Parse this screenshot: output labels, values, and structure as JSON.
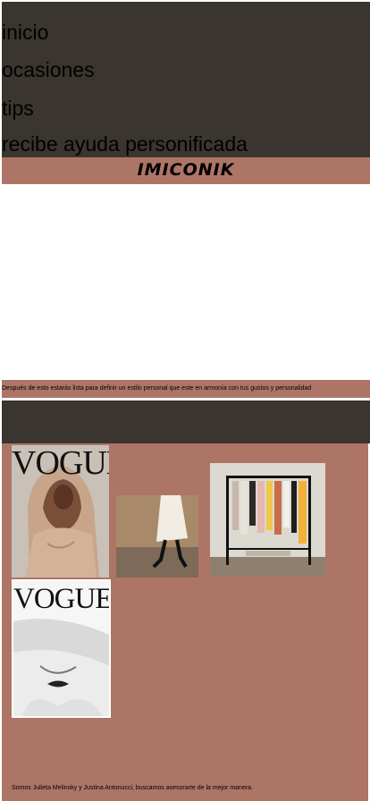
{
  "nav": {
    "items": [
      {
        "label": "inicio"
      },
      {
        "label": "ocasiones"
      },
      {
        "label": "tips"
      },
      {
        "label": "recibe ayuda personificada"
      }
    ]
  },
  "brand": {
    "name": "IMICONIK"
  },
  "info": {
    "text": "Después de esto estarás lista para definir un estilo personal que este en armonía con tus gustos y personalidad"
  },
  "gallery": {
    "vogue_cover_1_title": "VOGUE",
    "vogue_cover_2_title": "VOGUE"
  },
  "footer": {
    "text": "Somos Julieta Melinsky y Justina Antonucci, buscamos asesorarte de la mejor manera."
  },
  "colors": {
    "nav_bg": "#3a352e",
    "accent": "#ad7566"
  }
}
